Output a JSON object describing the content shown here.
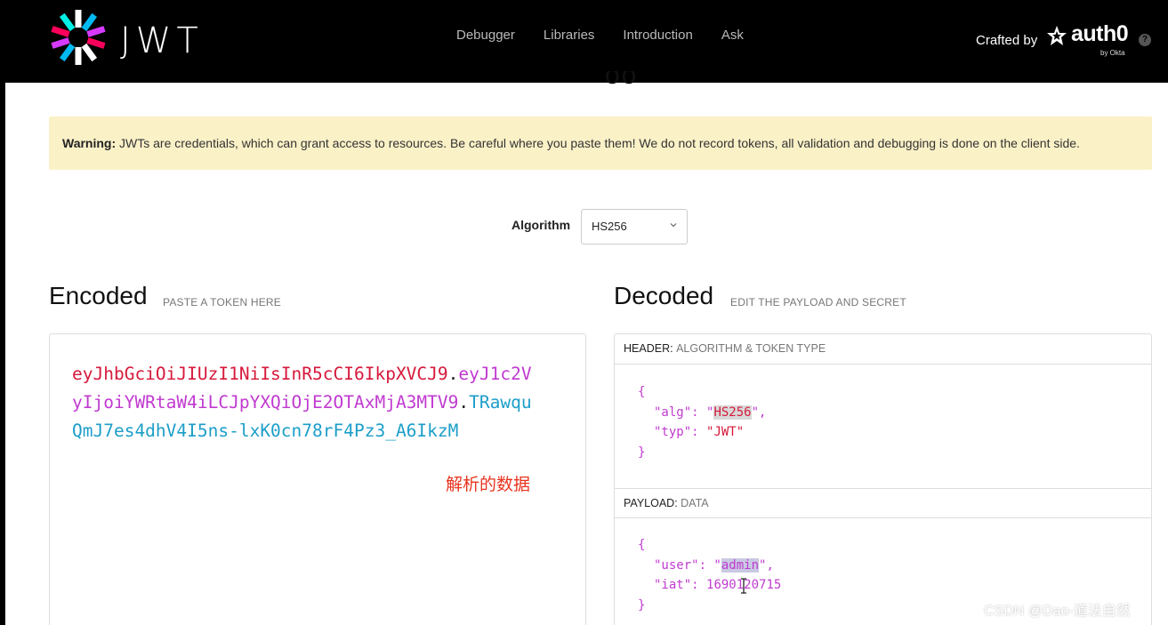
{
  "header": {
    "logo_text": "JWT",
    "nav": [
      "Debugger",
      "Libraries",
      "Introduction",
      "Ask"
    ],
    "crafted_by": "Crafted by",
    "brand": "auth0",
    "brand_sub": "by Okta",
    "help": "?"
  },
  "warning": {
    "label": "Warning:",
    "text": " JWTs are credentials, which can grant access to resources. Be careful where you paste them! We do not record tokens, all validation and debugging is done on the client side."
  },
  "algorithm": {
    "label": "Algorithm",
    "value": "HS256"
  },
  "encoded": {
    "title": "Encoded",
    "subtitle": "PASTE A TOKEN HERE",
    "token_header": "eyJhbGciOiJIUzI1NiIsInR5cCI6IkpXVCJ9",
    "dot1": ".",
    "token_payload": "eyJ1c2VyIjoiYWRtaW4iLCJpYXQiOjE2OTAxMjA3MTV9",
    "dot2": ".",
    "token_signature": "TRawquQmJ7es4dhV4I5ns-lxK0cn78rF4Pz3_A6IkzM",
    "annotation": "解析的数据"
  },
  "decoded": {
    "title": "Decoded",
    "subtitle": "EDIT THE PAYLOAD AND SECRET",
    "header_section": {
      "label": "HEADER:",
      "desc": "ALGORITHM & TOKEN TYPE",
      "open": "{",
      "alg_key": "\"alg\"",
      "alg_value": "HS256",
      "typ_key": "\"typ\"",
      "typ_value": "\"JWT\"",
      "close": "}"
    },
    "payload_section": {
      "label": "PAYLOAD:",
      "desc": "DATA",
      "open": "{",
      "user_key": "\"user\"",
      "user_value": "admin",
      "iat_key": "\"iat\"",
      "iat_value": "1690120715",
      "close": "}"
    }
  },
  "watermark": "CSDN @Dao-道法自然",
  "colors": {
    "token_header": "#d6193b",
    "token_payload": "#c03ad0",
    "token_signature": "#1c9ec9",
    "warning_bg": "#fbf1c7"
  }
}
